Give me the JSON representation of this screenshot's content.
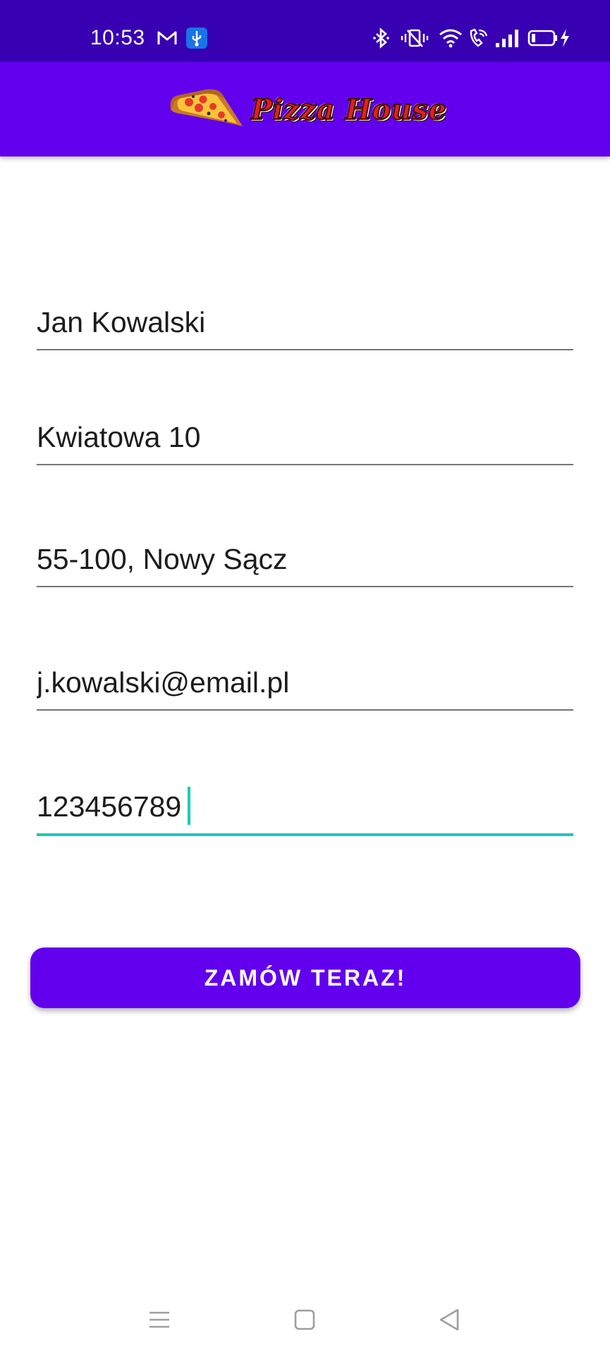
{
  "status_bar": {
    "time": "10:53",
    "left_icons": [
      "gmail-icon",
      "usb-debug-icon"
    ],
    "right_icons": [
      "bluetooth-icon",
      "vibrate-icon",
      "wifi-icon",
      "wifi-calling-icon",
      "signal-icon",
      "battery-charging-icon"
    ]
  },
  "app_bar": {
    "logo_text": "Pizza House"
  },
  "form": {
    "name": "Jan Kowalski",
    "address": "Kwiatowa 10",
    "city": "55-100, Nowy Sącz",
    "email": "j.kowalski@email.pl",
    "phone": "123456789"
  },
  "order_button": {
    "label": "ZAMÓW TERAZ!"
  },
  "colors": {
    "status_bar": "#3700b3",
    "primary": "#6200ee",
    "accent": "#1ec8b9"
  },
  "nav_bar": {
    "icons": [
      "menu-icon",
      "home-icon",
      "back-icon"
    ]
  }
}
